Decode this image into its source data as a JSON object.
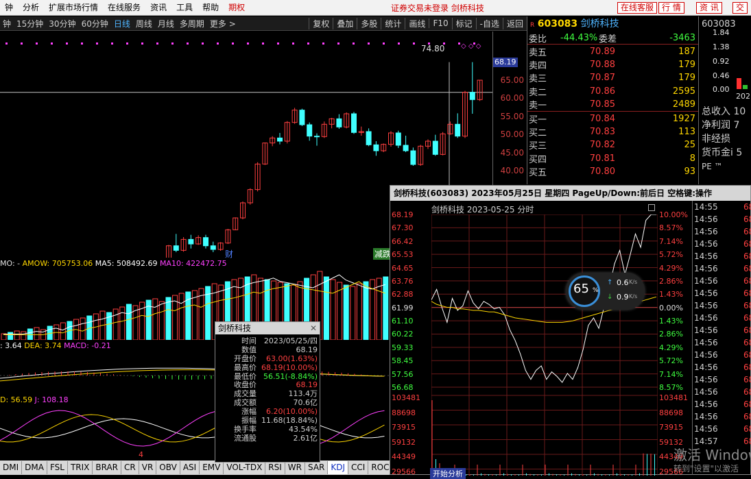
{
  "menu": {
    "items": [
      "﻿钟",
      "分析",
      "扩展市场行情",
      "在线服务",
      "资讯",
      "工具",
      "帮助",
      "期权"
    ],
    "notice": "证券交易未登录  剑桥科技",
    "right_buttons": [
      "在线客服",
      "行  情",
      "资  讯",
      "交"
    ]
  },
  "toolbar": {
    "periods": [
      "钟",
      "15分钟",
      "30分钟",
      "60分钟",
      "日线",
      "周线",
      "月线",
      "多周期",
      "更多 >"
    ],
    "active": "日线",
    "buttons": [
      "复权",
      "叠加",
      "多股",
      "统计",
      "画线",
      "F10",
      "标记",
      "-自选",
      "返回"
    ]
  },
  "kchart": {
    "price_axis": [
      "65.00",
      "60.00",
      "55.00",
      "50.00",
      "45.00",
      "40.00"
    ],
    "current_price_tag": "68.19",
    "high_label": "74.80",
    "markers": [
      "财",
      "减跌"
    ],
    "vol_header": {
      "mo": "MO: -",
      "amow": "AMOW: 705753.06",
      "ma5": "MA5: 508492.69",
      "ma10": "MA10: 422472.75"
    },
    "macd_header": {
      "dif": ": 3.64",
      "dea": "DEA: 3.74",
      "macd": "MACD: -0.21"
    },
    "kdj_header": {
      "d": "D: 56.59",
      "j": "J: 108.18"
    },
    "page_mark": "4",
    "candles": [
      [
        15,
        15.2,
        14.6,
        15.0
      ],
      [
        15,
        15.1,
        14.3,
        14.5
      ],
      [
        14.5,
        15.4,
        14.4,
        15.3
      ],
      [
        15.3,
        16.2,
        15.1,
        16.0
      ],
      [
        16,
        16.5,
        15.6,
        15.8
      ],
      [
        15.8,
        17.8,
        15.7,
        17.6
      ],
      [
        17.6,
        18.3,
        17.2,
        17.8
      ],
      [
        17.8,
        18.2,
        16.9,
        17.1
      ],
      [
        17.1,
        18.6,
        17.0,
        18.5
      ],
      [
        18.5,
        19.1,
        18.0,
        18.3
      ],
      [
        18.3,
        20.2,
        18.2,
        20.1
      ],
      [
        20.1,
        22.1,
        20.0,
        22.0
      ],
      [
        22,
        24.2,
        21.9,
        24.0
      ],
      [
        24,
        26.5,
        23.8,
        26.3
      ],
      [
        26.3,
        29.0,
        26.0,
        28.5
      ],
      [
        28.5,
        30.2,
        28.0,
        28.8
      ],
      [
        28.8,
        29.4,
        27.6,
        28.2
      ],
      [
        28.2,
        31.2,
        28.0,
        31.0
      ],
      [
        31,
        34.8,
        30.8,
        34.6
      ],
      [
        34.6,
        37.2,
        33.2,
        33.6
      ],
      [
        33.6,
        36.5,
        33.3,
        36.0
      ],
      [
        36,
        37.0,
        34.0,
        35.0
      ],
      [
        35,
        36.9,
        34.8,
        36.4
      ],
      [
        36.4,
        37.0,
        34.0,
        34.6
      ],
      [
        34.6,
        35.5,
        33.2,
        33.8
      ],
      [
        33.8,
        35.4,
        33.5,
        35.2
      ],
      [
        35.2,
        38.3,
        35.0,
        38.1
      ],
      [
        38.1,
        40.8,
        38.0,
        40.7
      ],
      [
        40.7,
        44.3,
        40.4,
        44.0
      ],
      [
        44,
        47.2,
        43.6,
        46.9
      ],
      [
        46.9,
        52.9,
        46.5,
        52.5
      ],
      [
        52.5,
        57.2,
        52.3,
        57.1
      ],
      [
        57.1,
        58.6,
        56.4,
        58.2
      ],
      [
        58.2,
        59.3,
        56.8,
        57.5
      ],
      [
        57.5,
        61.9,
        57.0,
        61.6
      ],
      [
        61.6,
        64.8,
        61.3,
        64.3
      ],
      [
        64.3,
        64.6,
        60.8,
        61.1
      ],
      [
        61.1,
        61.6,
        57.6,
        58.6
      ],
      [
        58.6,
        59.2,
        56.5,
        58.5
      ],
      [
        58.5,
        61.8,
        58.2,
        61.2
      ],
      [
        61.2,
        62.6,
        60.3,
        62.4
      ],
      [
        62.4,
        63.4,
        60.2,
        60.6
      ],
      [
        60.6,
        63.8,
        60.3,
        63.5
      ],
      [
        63.5,
        63.9,
        59.1,
        59.4
      ],
      [
        59.4,
        60.7,
        58.7,
        59.6
      ],
      [
        59.6,
        60.3,
        56.4,
        56.7
      ],
      [
        56.7,
        57.5,
        54.3,
        55.4
      ],
      [
        55.4,
        57.0,
        55.1,
        56.8
      ],
      [
        56.8,
        59.7,
        56.3,
        59.3
      ],
      [
        59.3,
        59.8,
        56.0,
        56.6
      ],
      [
        56.6,
        58.7,
        55.1,
        55.4
      ],
      [
        55.4,
        56.1,
        52.1,
        52.4
      ],
      [
        52.4,
        56.7,
        52.1,
        56.4
      ],
      [
        56.4,
        57.9,
        55.8,
        57.5
      ],
      [
        57.5,
        58.9,
        54.3,
        54.6
      ],
      [
        54.6,
        59.5,
        54.4,
        59.1
      ],
      [
        59.1,
        61.8,
        58.9,
        61.2
      ],
      [
        61.2,
        63.6,
        58.2,
        58.6
      ],
      [
        58.6,
        68.5,
        58.2,
        68.2
      ],
      [
        68.2,
        74.8,
        63.5,
        66.6
      ],
      [
        66.6,
        70.9,
        66.3,
        70.85
      ]
    ]
  },
  "quote": {
    "code": "603083",
    "name": "剑桥科技",
    "weibi_label": "委比",
    "weibi": "-44.43%",
    "weicha_label": "委差",
    "weicha": "-3463",
    "sell": [
      [
        "卖五",
        "70.89",
        "187"
      ],
      [
        "卖四",
        "70.88",
        "179"
      ],
      [
        "卖三",
        "70.87",
        "179"
      ],
      [
        "卖二",
        "70.86",
        "2595"
      ],
      [
        "卖一",
        "70.85",
        "2489"
      ]
    ],
    "buy": [
      [
        "买一",
        "70.84",
        "1927"
      ],
      [
        "买二",
        "70.83",
        "113"
      ],
      [
        "买三",
        "70.82",
        "25"
      ],
      [
        "买四",
        "70.81",
        "8"
      ],
      [
        "买五",
        "70.80",
        "93"
      ]
    ]
  },
  "side": {
    "code": "603083",
    "scale": [
      "1.84",
      "1.38",
      "0.92",
      "0.46",
      "0.00"
    ],
    "labels": [
      "总收入 10",
      "净利润 7",
      "非经损",
      "货币金i 5"
    ],
    "year": "202",
    "pe": "PE ™"
  },
  "popup": {
    "title": "剑桥科技(603083) 2023年05月25日 星期四 PageUp/Down:前后日 空格键:操作",
    "subtitle": "剑桥科技  2023-05-25 分时",
    "left_axis": [
      "68.19",
      "67.30",
      "66.42",
      "65.53",
      "64.65",
      "63.76",
      "62.88",
      "61.99",
      "61.10",
      "60.22",
      "59.33",
      "58.45",
      "57.56",
      "56.68"
    ],
    "right_axis": [
      "10.00%",
      "8.57%",
      "7.14%",
      "5.72%",
      "4.29%",
      "2.86%",
      "1.43%",
      "0.00%",
      "1.43%",
      "2.86%",
      "4.29%",
      "5.72%",
      "7.14%",
      "8.57%"
    ],
    "vol_left": [
      "103481",
      "88698",
      "73915",
      "59132",
      "44349",
      "29566"
    ],
    "vol_right": [
      "103481",
      "88698",
      "73915",
      "59132",
      "44349",
      "29566"
    ],
    "time_col": [
      "14:55",
      "14:56",
      "14:56",
      "14:56",
      "14:56",
      "14:56",
      "14:56",
      "14:56",
      "14:56",
      "14:56",
      "14:56",
      "14:56",
      "14:56",
      "14:56",
      "14:56",
      "14:56",
      "14:56",
      "14:56",
      "14:56",
      "14:57"
    ],
    "price_col": [
      "68",
      "68",
      "68",
      "68",
      "68",
      "68",
      "68",
      "68",
      "68",
      "68",
      "68",
      "68",
      "68",
      "68",
      "68",
      "68",
      "68",
      "68",
      "68",
      "68"
    ],
    "bottom_tab": "开始分析",
    "intraday": [
      62.5,
      63.2,
      62.0,
      61.0,
      62.6,
      61.8,
      62.1,
      63.1,
      62.3,
      61.9,
      62.4,
      62.2,
      61.9,
      62.0,
      61.5,
      60.5,
      59.8,
      58.9,
      57.8,
      57.2,
      57.8,
      58.1,
      57.2,
      57.7,
      57.4,
      57.0,
      57.6,
      57.2,
      58.0,
      59.2,
      60.8,
      61.3,
      60.6,
      62.0,
      63.3,
      64.9,
      65.8,
      64.2,
      65.5,
      66.9,
      66.0,
      67.8,
      68.19,
      68.19
    ],
    "avg": [
      62.4,
      62.2,
      62.1,
      62.0,
      62.0,
      61.9,
      61.9,
      61.85,
      61.8,
      61.8,
      61.75,
      61.7,
      61.7,
      61.6,
      61.5,
      61.4,
      61.3,
      61.25,
      61.2,
      61.15,
      61.1,
      61.05,
      61.0,
      61.0,
      61.0,
      61.0,
      61.05,
      61.1,
      61.2,
      61.3,
      61.4,
      61.5,
      61.6,
      61.7,
      61.8,
      61.9,
      62.0,
      62.1,
      62.2,
      62.3,
      62.4,
      62.5,
      62.6,
      62.7
    ]
  },
  "speed": {
    "percent": "65",
    "unit": "%",
    "up": "0.6",
    "down": "0.9",
    "rate_unit": "K/s"
  },
  "infobox": {
    "title": "剑桥科技",
    "rows": [
      [
        "时间",
        "2023/05/25/四"
      ],
      [
        "数值",
        "68.19"
      ],
      [
        "开盘价",
        "63.00(1.63%)"
      ],
      [
        "最高价",
        "68.19(10.00%)"
      ],
      [
        "最低价",
        "56.51(-8.84%)"
      ],
      [
        "收盘价",
        "68.19"
      ],
      [
        "成交量",
        "113.4万"
      ],
      [
        "成交额",
        "70.6亿"
      ],
      [
        "涨幅",
        "6.20(10.00%)"
      ],
      [
        "振幅",
        "11.68(18.84%)"
      ],
      [
        "换手率",
        "43.54%"
      ],
      [
        "流通股",
        "2.61亿"
      ]
    ]
  },
  "tabs": [
    "DMI",
    "DMA",
    "FSL",
    "TRIX",
    "BRAR",
    "CR",
    "VR",
    "OBV",
    "ASI",
    "EMV",
    "VOL-TDX",
    "RSI",
    "WR",
    "SAR",
    "KDJ",
    "CCI",
    "ROC",
    "MTM"
  ],
  "active_tab": "KDJ",
  "watermark": {
    "line1": "激活 Windows",
    "line2": "转到\"设置\"以激活"
  },
  "colors": {
    "up": "#ff4040",
    "down": "#40ffff",
    "accent_yellow": "#ffd700",
    "blue": "#4fb5ff"
  }
}
